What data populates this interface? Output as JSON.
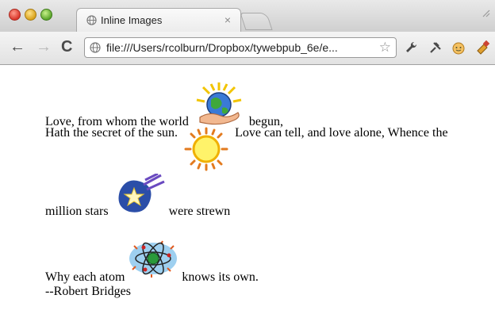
{
  "window": {
    "tab_title": "Inline Images",
    "tab_close": "×",
    "url": "file:///Users/rcolburn/Dropbox/tywebpub_6e/e..."
  },
  "toolbar": {
    "back_glyph": "←",
    "forward_glyph": "→",
    "reload_glyph": "C",
    "star_glyph": "☆"
  },
  "poem": {
    "l1a": "Love, from whom the world",
    "l1b": "begun,",
    "l2a": "Hath the secret of the sun.",
    "l2b": "Love can tell, and love alone, Whence the",
    "l3a": "million stars",
    "l3b": "were strewn",
    "l4a": "Why each atom",
    "l4b": "knows its own.",
    "attribution": "--Robert Bridges"
  },
  "icons": {
    "earth": "earth-in-hand-icon",
    "sun": "sun-icon",
    "star": "shooting-star-icon",
    "atom": "atom-icon"
  }
}
